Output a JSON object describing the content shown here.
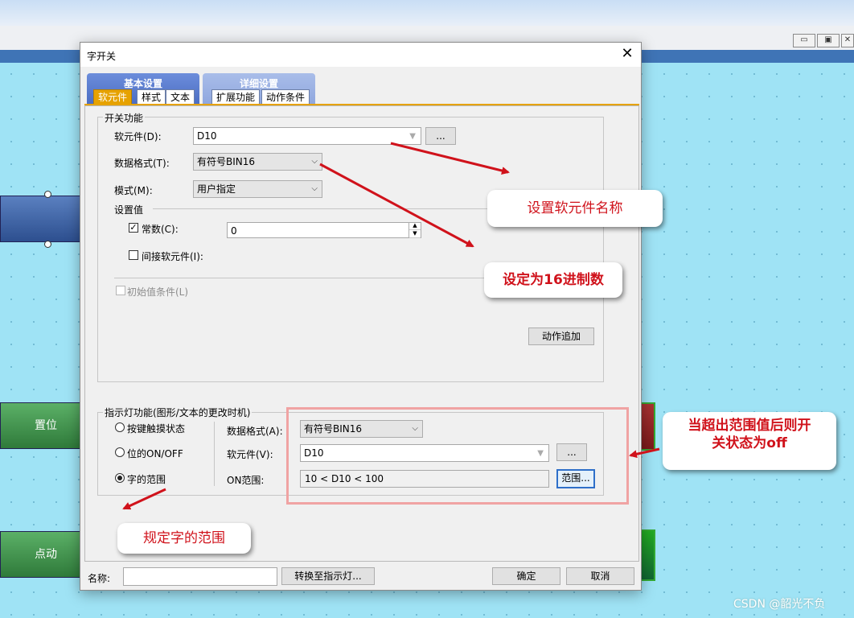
{
  "background": {
    "buttons": {
      "set": "置位",
      "jog": "点动"
    },
    "window_controls": [
      "minimize-icon",
      "restore-icon",
      "close-icon"
    ]
  },
  "dialog": {
    "title": "字开关",
    "tab_groups": [
      {
        "title": "基本设置",
        "tabs": [
          "软元件",
          "样式",
          "文本"
        ]
      },
      {
        "title": "详细设置",
        "tabs": [
          "扩展功能",
          "动作条件"
        ]
      }
    ],
    "switch_function": {
      "legend": "开关功能",
      "device_label": "软元件(D):",
      "device_value": "D10",
      "browse_label": "...",
      "data_format_label": "数据格式(T):",
      "data_format_value": "有符号BIN16",
      "mode_label": "模式(M):",
      "mode_value": "用户指定",
      "set_value_label": "设置值",
      "constant_label": "常数(C):",
      "constant_value": "0",
      "indirect_label": "间接软元件(I):",
      "init_cond_label": "初始值条件(L)",
      "add_action_label": "动作追加"
    },
    "indicator": {
      "legend": "指示灯功能(图形/文本的更改时机)",
      "options": [
        "按键触摸状态",
        "位的ON/OFF",
        "字的范围"
      ],
      "selected": "字的范围",
      "data_format_label": "数据格式(A):",
      "data_format_value": "有符号BIN16",
      "device_label": "软元件(V):",
      "device_value": "D10",
      "browse_label": "...",
      "on_range_label": "ON范围:",
      "on_range_value": "10 < D10 < 100",
      "range_button": "范围..."
    },
    "footer": {
      "name_label": "名称:",
      "name_value": "",
      "convert_button": "转换至指示灯...",
      "ok_button": "确定",
      "cancel_button": "取消"
    }
  },
  "annotations": {
    "device_name": "设置软元件名称",
    "hex_format": "设定为16进制数",
    "off_state_line1": "当超出范围值后则开",
    "off_state_line2": "关状态为off",
    "word_range": "规定字的范围",
    "color": "#d0121b"
  },
  "watermark": "CSDN @韶光不负"
}
